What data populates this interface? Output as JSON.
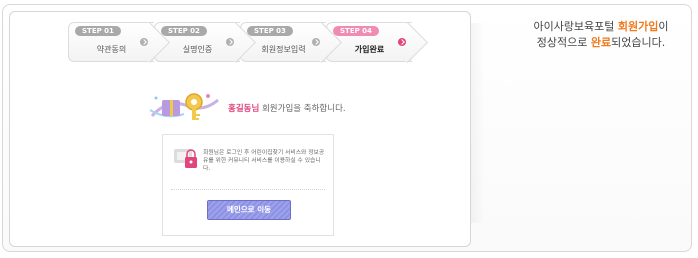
{
  "steps": [
    {
      "badge": "STEP 01",
      "label": "약관동의",
      "active": false
    },
    {
      "badge": "STEP 02",
      "label": "실명인증",
      "active": false
    },
    {
      "badge": "STEP 03",
      "label": "회원정보입력",
      "active": false
    },
    {
      "badge": "STEP 04",
      "label": "가입완료",
      "active": true
    }
  ],
  "welcome": {
    "name": "홍길동님",
    "message": " 회원가입을 축하합니다."
  },
  "info": {
    "text": "회원님은 로그인 후 어린이집찾기 서비스와 정보공유를 위한 커뮤니티 서비스를 이용하실 수 있습니다.",
    "button_label": "메인으로 이동"
  },
  "side": {
    "line1_prefix": "아이사랑보육포털 ",
    "line1_highlight": "회원가입",
    "line1_suffix": "이",
    "line2_prefix": "정상적으로 ",
    "line2_highlight": "완료",
    "line2_suffix": "되었습니다."
  },
  "colors": {
    "accent_pink": "#e0457d",
    "accent_orange": "#f07a1e",
    "button_purple": "#8c91e3"
  },
  "icons": {
    "welcome": "gift-key-icon",
    "info": "lock-icon"
  }
}
